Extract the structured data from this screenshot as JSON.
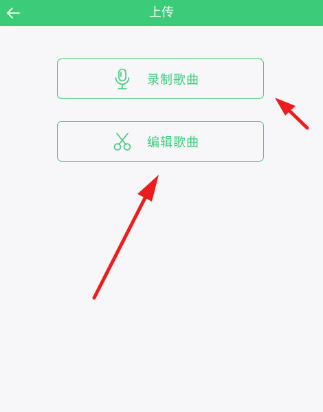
{
  "header": {
    "title": "上传",
    "back_icon": "arrow-left-icon"
  },
  "actions": [
    {
      "label": "录制歌曲",
      "icon": "microphone-icon"
    },
    {
      "label": "编辑歌曲",
      "icon": "scissors-icon"
    }
  ],
  "colors": {
    "accent": "#3ccb78",
    "background": "#f7f6f8",
    "annotation_arrow": "#ee1c1c"
  }
}
